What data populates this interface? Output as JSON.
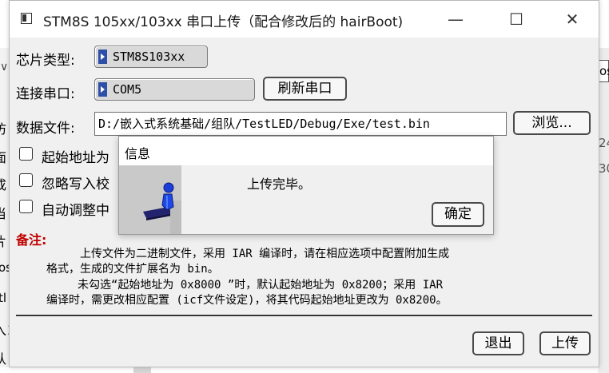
{
  "window": {
    "title": "STM8S 105xx/103xx 串口上传（配合修改后的 hairBoot)",
    "minimize": "—",
    "maximize": "☐",
    "close": "✕"
  },
  "chip": {
    "label": "芯片类型:",
    "value": "STM8S103xx"
  },
  "port": {
    "label": "连接串口:",
    "value": "COM5",
    "refresh": "刷新串口"
  },
  "file": {
    "label": "数据文件:",
    "value": "D:/嵌入式系统基础/组队/TestLED/Debug/Exe/test.bin",
    "browse": "浏览..."
  },
  "options": [
    {
      "label": "起始地址为",
      "checked": false
    },
    {
      "label": "忽略写入校",
      "checked": false
    },
    {
      "label": "自动调整中",
      "checked": false
    }
  ],
  "note": {
    "title": "备注:",
    "lines": [
      "上传文件为二进制文件，采用 IAR 编译时，请在相应选项中配置附加生成",
      "格式，生成的文件扩展名为 bin。",
      "未勾选“起始地址为 0x8000 ”时，默认起始地址为 0x8200；采用 IAR",
      "编译时，需更改相应配置 (icf文件设定)，将其代码起始地址更改为 0x8200。"
    ]
  },
  "buttons": {
    "exit": "退出",
    "upload": "上传"
  },
  "dialog": {
    "title": "信息",
    "message": "上传完毕。",
    "ok": "确定",
    "icon": "info-person-icon"
  },
  "background": {
    "left_fragments": [
      "∨",
      "仿",
      "面",
      "成",
      "当",
      "片",
      "os",
      "tl",
      "入ヨ",
      "认"
    ],
    "right_fragments": [
      "os_",
      "24",
      "30"
    ]
  }
}
